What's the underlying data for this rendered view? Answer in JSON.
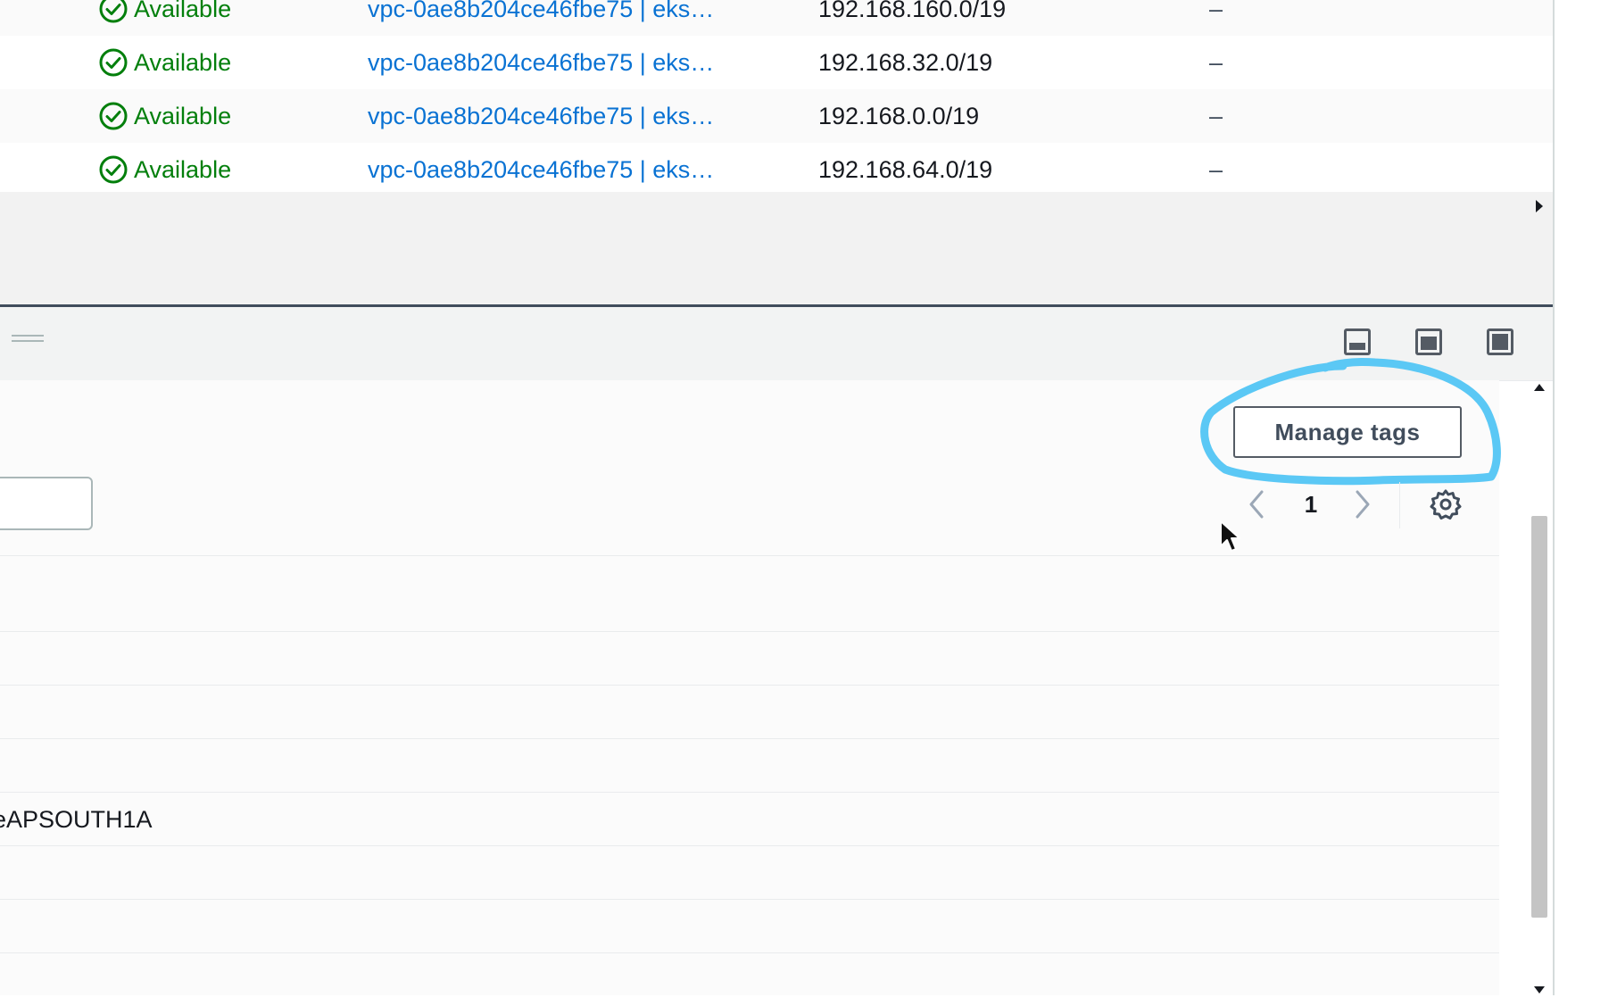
{
  "subnets": {
    "rows": [
      {
        "status": "Available",
        "vpc": "vpc-0ae8b204ce46fbe75 | eks…",
        "cidr": "192.168.160.0/19",
        "ipv6": "–"
      },
      {
        "status": "Available",
        "vpc": "vpc-0ae8b204ce46fbe75 | eks…",
        "cidr": "192.168.32.0/19",
        "ipv6": "–"
      },
      {
        "status": "Available",
        "vpc": "vpc-0ae8b204ce46fbe75 | eks…",
        "cidr": "192.168.0.0/19",
        "ipv6": "–"
      },
      {
        "status": "Available",
        "vpc": "vpc-0ae8b204ce46fbe75 | eks…",
        "cidr": "192.168.64.0/19",
        "ipv6": "–"
      }
    ],
    "status_color": "#037f0c",
    "link_color": "#0972d3"
  },
  "split_panel": {
    "position_buttons": [
      "panel-bottom-icon",
      "panel-side-icon",
      "panel-full-icon"
    ],
    "manage_tags_label": "Manage tags",
    "pagination": {
      "current_page": "1"
    },
    "rows": [
      "",
      "",
      "",
      "",
      "eAPSOUTH1A",
      "",
      "",
      ""
    ],
    "highlight_color": "#5bc8f5"
  }
}
